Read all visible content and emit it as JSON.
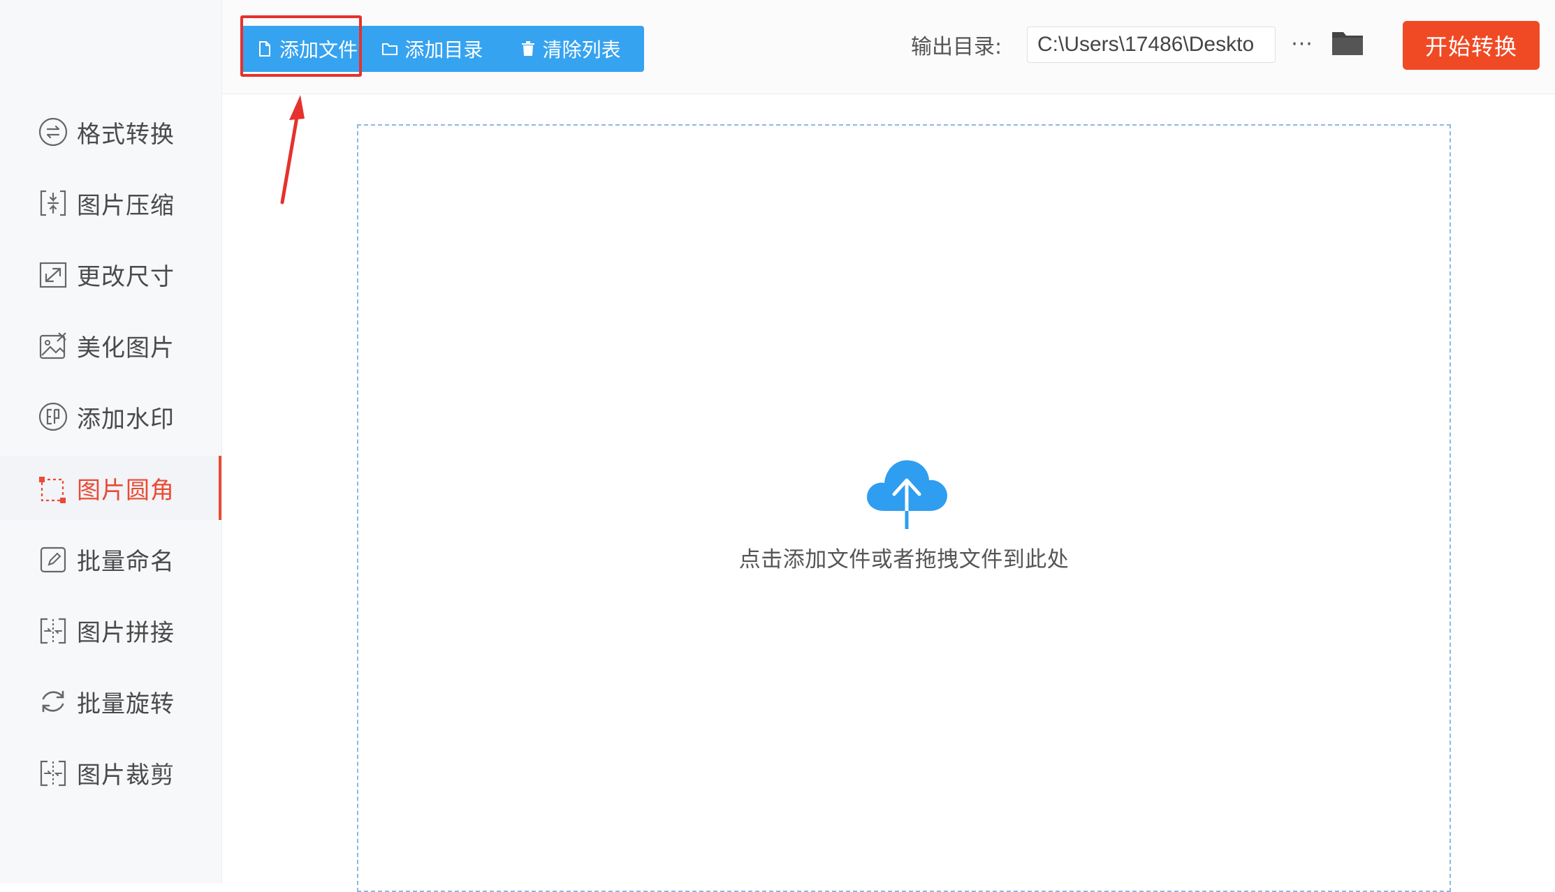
{
  "sidebar": {
    "items": [
      {
        "label": "格式转换",
        "icon": "format-convert-icon"
      },
      {
        "label": "图片压缩",
        "icon": "compress-icon"
      },
      {
        "label": "更改尺寸",
        "icon": "resize-icon"
      },
      {
        "label": "美化图片",
        "icon": "beautify-icon"
      },
      {
        "label": "添加水印",
        "icon": "watermark-icon"
      },
      {
        "label": "图片圆角",
        "icon": "rounded-corner-icon",
        "active": true
      },
      {
        "label": "批量命名",
        "icon": "rename-icon"
      },
      {
        "label": "图片拼接",
        "icon": "stitch-icon"
      },
      {
        "label": "批量旋转",
        "icon": "rotate-icon"
      },
      {
        "label": "图片裁剪",
        "icon": "crop-icon"
      }
    ]
  },
  "toolbar": {
    "add_file_label": "添加文件",
    "add_dir_label": "添加目录",
    "clear_list_label": "清除列表",
    "output_label": "输出目录:",
    "output_path": "C:\\Users\\17486\\Deskto",
    "more_label": "···",
    "start_label": "开始转换"
  },
  "dropzone": {
    "hint": "点击添加文件或者拖拽文件到此处"
  },
  "colors": {
    "accent_blue": "#36a3f0",
    "start_orange": "#f04a25",
    "active_red": "#e94b35",
    "annotation_red": "#e5322d"
  }
}
